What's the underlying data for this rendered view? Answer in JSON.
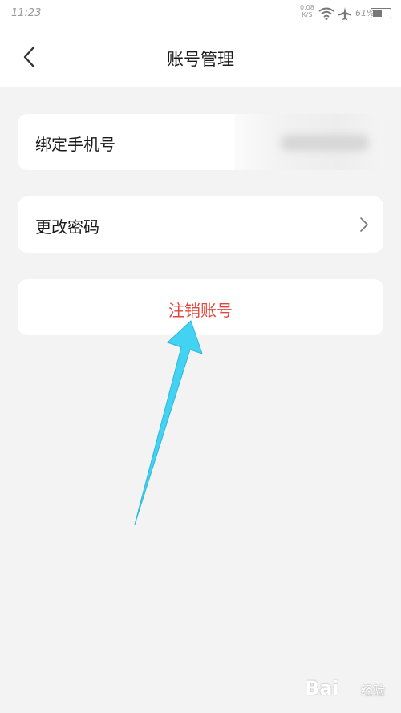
{
  "status_bar": {
    "time": "11:23",
    "net_speed": "0.08",
    "net_unit": "K/S",
    "battery": "61%",
    "battery_level": 0.61,
    "icons": [
      "wifi-icon",
      "airplane-icon",
      "battery-icon"
    ]
  },
  "header": {
    "title": "账号管理",
    "back_icon": "chevron-left-icon"
  },
  "settings": {
    "bind_phone_label": "绑定手机号",
    "change_password_label": "更改密码",
    "deregister_label": "注销账号"
  },
  "colors": {
    "danger": "#e0463d",
    "annotation_arrow": "#44d2f2",
    "background": "#f3f3f3"
  },
  "watermark": {
    "logo": "Bai",
    "text": "经验"
  }
}
